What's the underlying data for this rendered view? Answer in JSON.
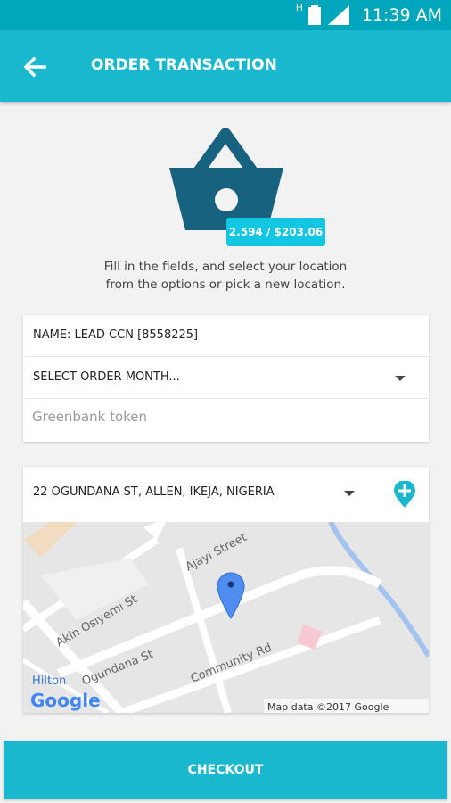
{
  "status_bar": {
    "time": "11:39 AM",
    "network_badge": "H"
  },
  "app_bar": {
    "title": "ORDER TRANSACTION"
  },
  "order": {
    "price_badge": "2.594 / $203.06"
  },
  "instructions": {
    "line1": "Fill in the fields, and select your location",
    "line2": "from the options or pick a new location."
  },
  "form": {
    "name": "NAME: LEAD CCN [8558225]",
    "order_month": "SELECT ORDER MONTH...",
    "token_placeholder": "Greenbank token"
  },
  "location": {
    "address": "22 OGUNDANA ST, ALLEN, IKEJA, NIGERIA"
  },
  "map": {
    "street_labels": [
      "Ajayi Street",
      "Akin Osiyemi St",
      "Ogundana St",
      "Community Rd"
    ],
    "poi_label": "Hilton",
    "attribution": "Map data ©2017 Google",
    "logo": "Google"
  },
  "footer": {
    "checkout_label": "CHECKOUT"
  },
  "colors": {
    "primary": "#1ab8ce",
    "accent": "#13c7e3",
    "basket": "#17627e",
    "pin": "#4f8ef0"
  },
  "icons": [
    "back-arrow-icon",
    "basket-icon",
    "dropdown-arrow-icon",
    "add-location-icon",
    "map-pin-icon"
  ]
}
